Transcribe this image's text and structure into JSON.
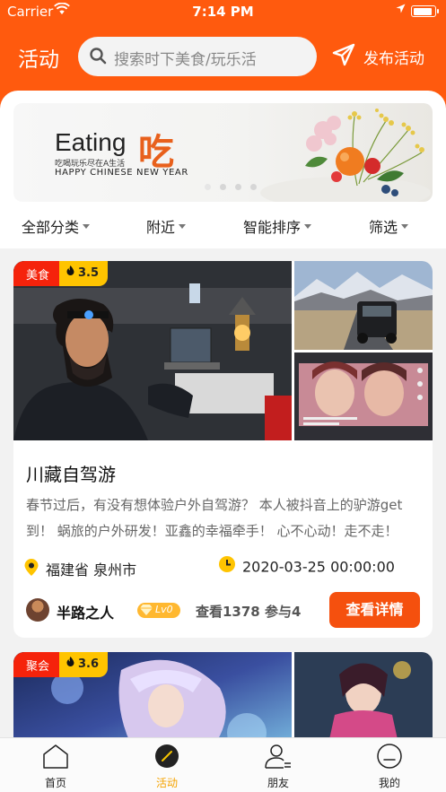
{
  "status_bar": {
    "carrier": "Carrier",
    "time": "7:14 PM",
    "battery_level": 0.9
  },
  "header": {
    "title": "活动",
    "search": {
      "placeholder": "搜索时下美食/玩乐活",
      "icon": "search-icon"
    },
    "publish_label": "发布活动"
  },
  "banner": {
    "title": "Eating",
    "title_cn": "吃",
    "subtitle": "吃喝玩乐尽在A生活",
    "tagline": "HAPPY CHINESE NEW YEAR",
    "page_count": 4,
    "active_page": 0
  },
  "filters": [
    {
      "label": "全部分类"
    },
    {
      "label": "附近"
    },
    {
      "label": "智能排序"
    },
    {
      "label": "筛选"
    }
  ],
  "activities": [
    {
      "category": "美食",
      "heat": "3.5",
      "title": "川藏自驾游",
      "description": "春节过后，有没有想体验户外自驾游？ 本人被抖音上的驴游get到！ 蜗旅的户外研发！亚鑫的幸福牵手！ 心不心动！走不走！",
      "location": "福建省 泉州市",
      "time": "2020-03-25 00:00:00",
      "user": {
        "name": "半路之人",
        "level": "Lv0"
      },
      "stats": "查看1378 参与4",
      "button": "查看详情"
    },
    {
      "category": "聚会",
      "heat": "3.6"
    }
  ],
  "tabs": [
    {
      "label": "首页",
      "icon": "home-icon"
    },
    {
      "label": "活动",
      "icon": "activity-icon",
      "active": true
    },
    {
      "label": "朋友",
      "icon": "friends-icon"
    },
    {
      "label": "我的",
      "icon": "profile-icon"
    }
  ],
  "colors": {
    "brand": "#ff5a0e",
    "tag_red": "#f5230b",
    "tag_yellow": "#ffc400",
    "button": "#f5500e",
    "active_tab": "#f5a300"
  }
}
